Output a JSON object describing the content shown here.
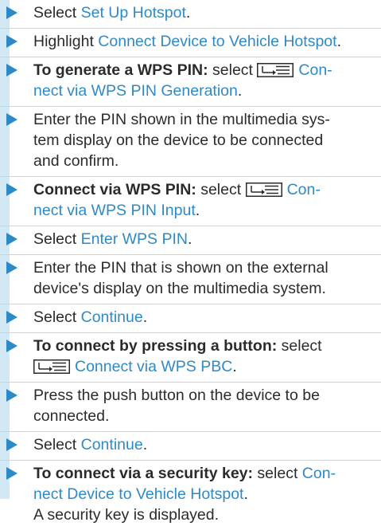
{
  "steps": [
    {
      "pre": "Select ",
      "link": "Set Up Hotspot",
      "post": "."
    },
    {
      "pre": "Highlight ",
      "link": "Connect Device to Vehicle Hotspot",
      "post": "."
    },
    {
      "bold": "To generate a WPS PIN:",
      "pre": " select ",
      "icon": "menu-icon",
      "link1": "Con-",
      "link2": "nect via WPS PIN Generation",
      "post": "."
    },
    {
      "line1": "Enter the PIN shown in the multimedia sys-",
      "line2": "tem display on the device to be connected",
      "line3": "and confirm."
    },
    {
      "bold": "Connect via WPS PIN:",
      "pre": " select ",
      "icon": "menu-icon",
      "link1": "Con-",
      "link2": "nect via WPS PIN Input",
      "post": "."
    },
    {
      "pre": "Select ",
      "link": "Enter WPS PIN",
      "post": "."
    },
    {
      "line1": "Enter the PIN that is shown on the external",
      "line2": "device's display on the multimedia system."
    },
    {
      "pre": "Select ",
      "link": "Continue",
      "post": "."
    },
    {
      "bold": "To connect by pressing a button:",
      "pre": " select",
      "icon": "menu-icon",
      "link": "Connect via WPS PBC",
      "post": "."
    },
    {
      "line1": "Press the push button on the device to be",
      "line2": "connected."
    },
    {
      "pre": "Select ",
      "link": "Continue",
      "post": "."
    },
    {
      "bold": "To connect via a security key:",
      "pre": " select ",
      "link1": "Con-",
      "link2": "nect Device to Vehicle Hotspot",
      "post": ".",
      "note": "A security key is displayed."
    }
  ],
  "colors": {
    "accent": "#2e8ac6",
    "stripe": "#d3e8f5",
    "divider": "#b9d9ec",
    "text": "#2b2b2b"
  }
}
